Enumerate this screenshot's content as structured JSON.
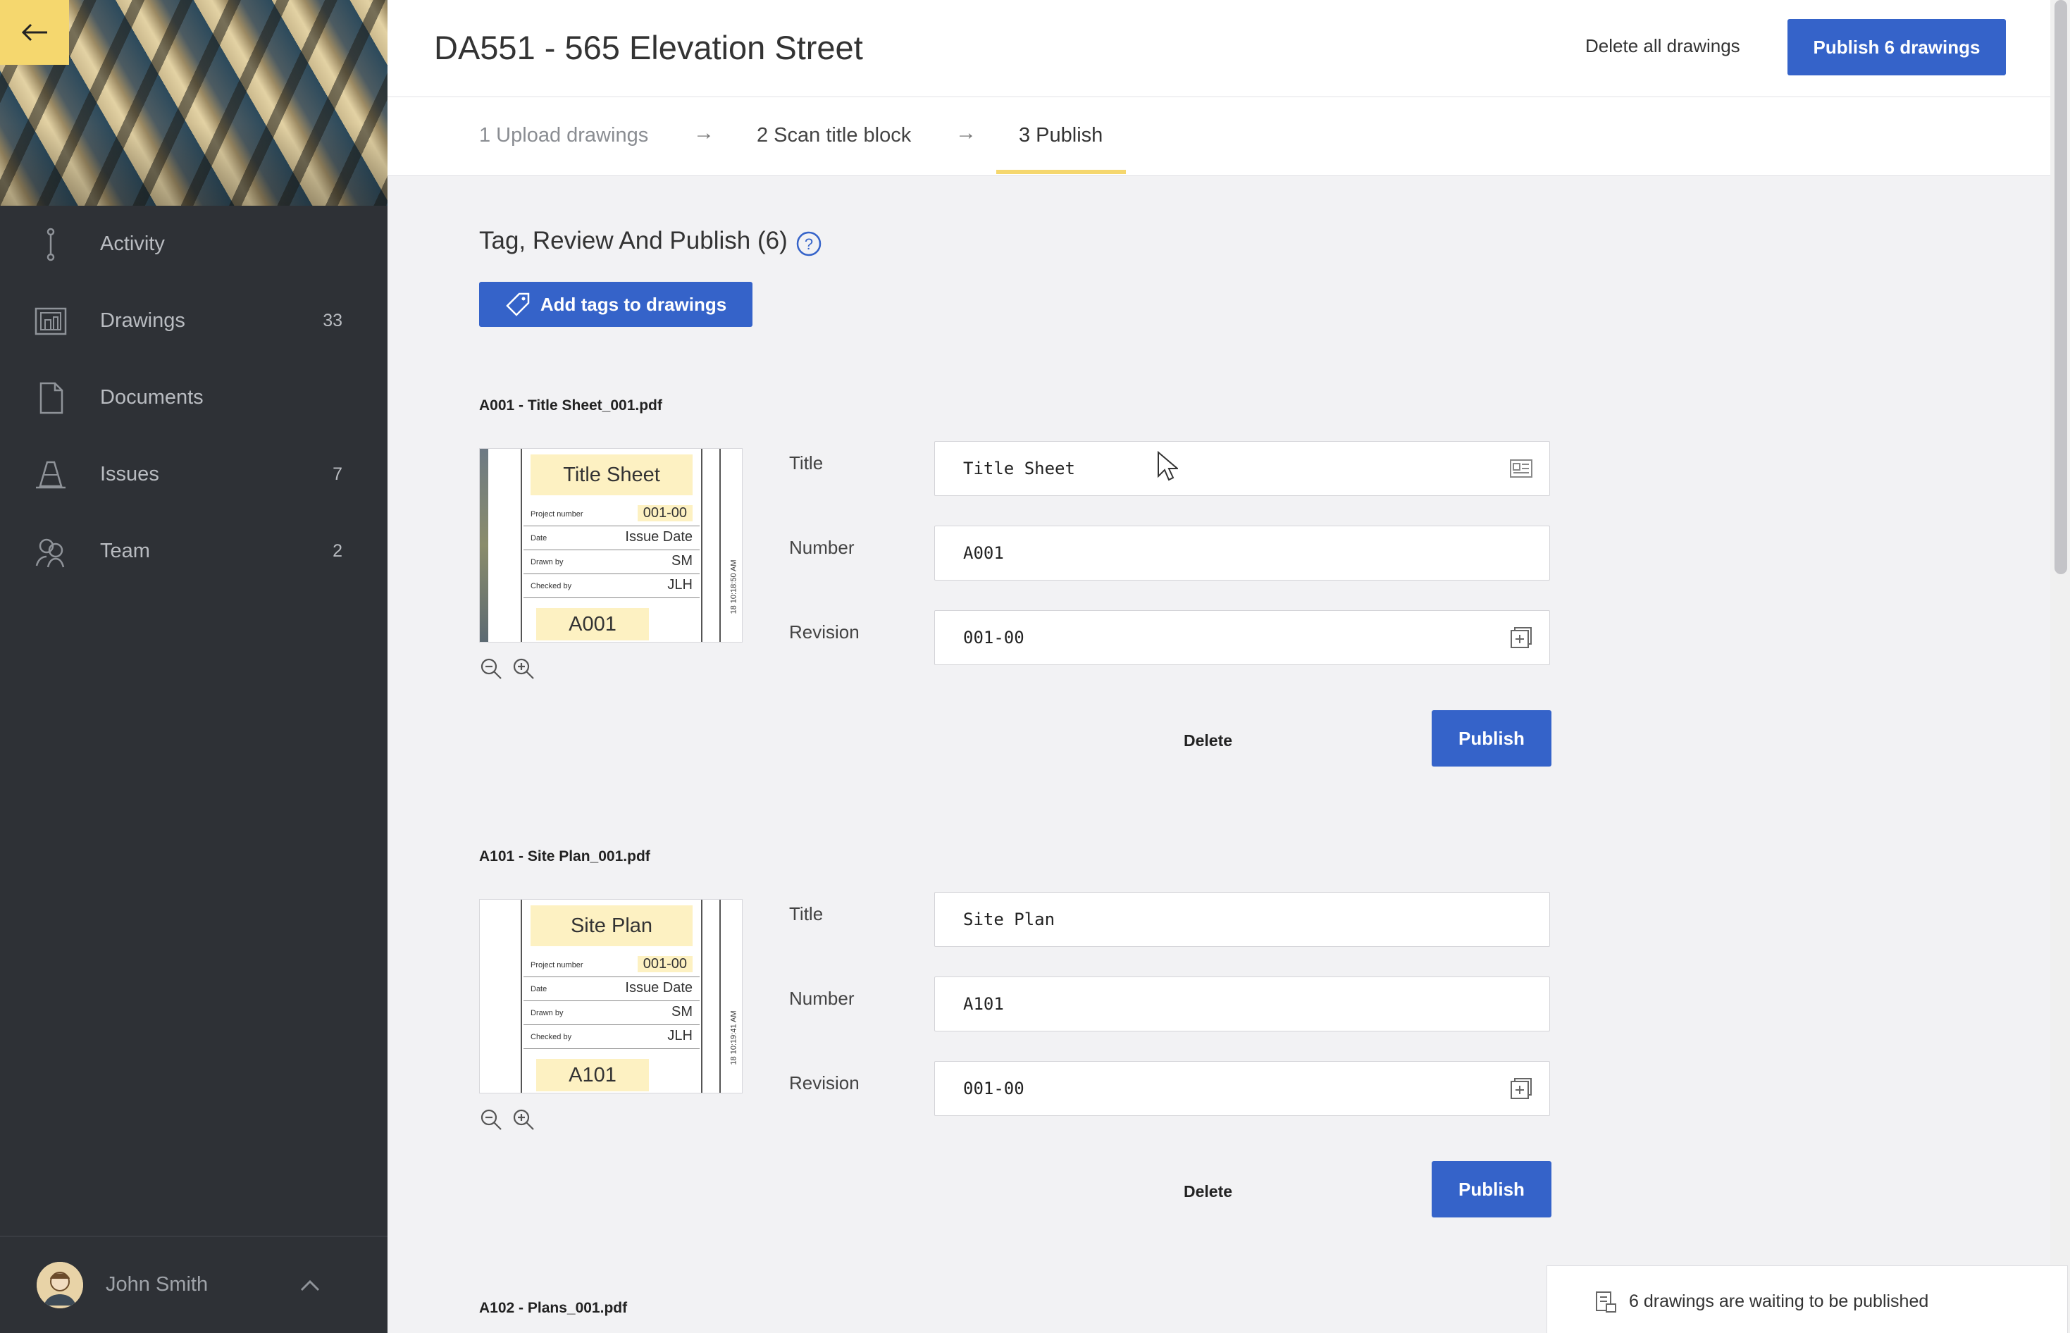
{
  "sidebar": {
    "items": [
      {
        "label": "Activity",
        "count": "",
        "icon": "activity-icon"
      },
      {
        "label": "Drawings",
        "count": "33",
        "icon": "drawings-icon"
      },
      {
        "label": "Documents",
        "count": "",
        "icon": "document-icon"
      },
      {
        "label": "Issues",
        "count": "7",
        "icon": "cone-icon"
      },
      {
        "label": "Team",
        "count": "2",
        "icon": "team-icon"
      }
    ],
    "user": {
      "name": "John Smith"
    }
  },
  "header": {
    "title": "DA551 - 565 Elevation Street",
    "delete_all_label": "Delete all drawings",
    "publish_all_label": "Publish 6 drawings"
  },
  "steps": [
    {
      "label": "1 Upload drawings"
    },
    {
      "label": "2 Scan title block"
    },
    {
      "label": "3 Publish"
    }
  ],
  "step_arrow": "→",
  "section": {
    "title": "Tag, Review And Publish (6)",
    "add_tags_label": "Add tags to drawings"
  },
  "drawings": [
    {
      "file": "A001 - Title Sheet_001.pdf",
      "thumb": {
        "title": "Title Sheet",
        "rows": [
          {
            "key": "Project number",
            "value": "001-00"
          },
          {
            "key": "Date",
            "value": "Issue Date"
          },
          {
            "key": "Drawn by",
            "value": "SM"
          },
          {
            "key": "Checked by",
            "value": "JLH"
          }
        ],
        "number": "A001",
        "vertical_text": "18 10:18:50 AM"
      },
      "labels": {
        "title": "Title",
        "number": "Number",
        "revision": "Revision"
      },
      "values": {
        "title": "Title Sheet",
        "number": "A001",
        "revision": "001-00"
      },
      "delete_label": "Delete",
      "publish_label": "Publish"
    },
    {
      "file": "A101 - Site Plan_001.pdf",
      "thumb": {
        "title": "Site Plan",
        "rows": [
          {
            "key": "Project number",
            "value": "001-00"
          },
          {
            "key": "Date",
            "value": "Issue Date"
          },
          {
            "key": "Drawn by",
            "value": "SM"
          },
          {
            "key": "Checked by",
            "value": "JLH"
          }
        ],
        "number": "A101",
        "vertical_text": "18 10:19:41 AM"
      },
      "labels": {
        "title": "Title",
        "number": "Number",
        "revision": "Revision"
      },
      "values": {
        "title": "Site Plan",
        "number": "A101",
        "revision": "001-00"
      },
      "delete_label": "Delete",
      "publish_label": "Publish"
    },
    {
      "file": "A102 - Plans_001.pdf"
    }
  ],
  "toast": {
    "message": "6 drawings are waiting to be published"
  },
  "colors": {
    "accent": "#3563c9",
    "highlight": "#f5d76e",
    "sidebar": "#2e3136"
  }
}
